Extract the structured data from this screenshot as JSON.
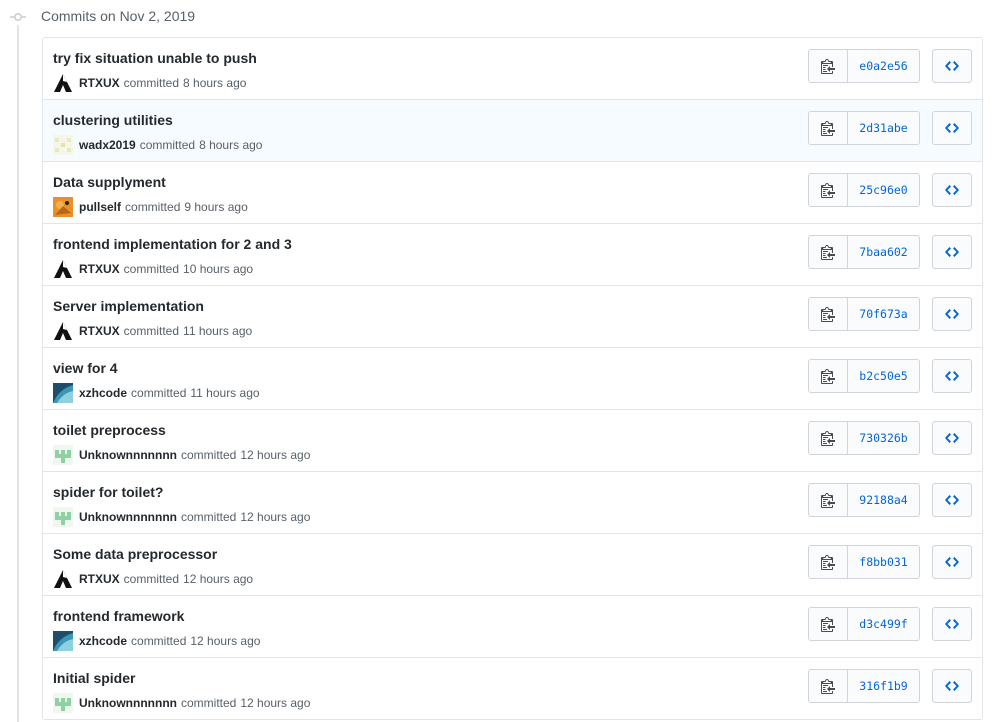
{
  "group": {
    "title": "Commits on Nov 2, 2019"
  },
  "colors": {
    "link": "#0366d6",
    "border": "#e1e4e8",
    "hover_row": "#f6fbff"
  },
  "icons": {
    "timeline": "git-commit-icon",
    "copy": "clippy-icon",
    "browse": "code-icon"
  },
  "commits": [
    {
      "message": "try fix situation unable to push",
      "author": "RTXUX",
      "verb": "committed",
      "time": "8 hours ago",
      "sha": "e0a2e56",
      "avatar": "rtxux"
    },
    {
      "message": "clustering utilities",
      "author": "wadx2019",
      "verb": "committed",
      "time": "8 hours ago",
      "sha": "2d31abe",
      "avatar": "wadx"
    },
    {
      "message": "Data supplyment",
      "author": "pullself",
      "verb": "committed",
      "time": "9 hours ago",
      "sha": "25c96e0",
      "avatar": "pullself"
    },
    {
      "message": "frontend implementation for 2 and 3",
      "author": "RTXUX",
      "verb": "committed",
      "time": "10 hours ago",
      "sha": "7baa602",
      "avatar": "rtxux"
    },
    {
      "message": "Server implementation",
      "author": "RTXUX",
      "verb": "committed",
      "time": "11 hours ago",
      "sha": "70f673a",
      "avatar": "rtxux"
    },
    {
      "message": "view for 4",
      "author": "xzhcode",
      "verb": "committed",
      "time": "11 hours ago",
      "sha": "b2c50e5",
      "avatar": "xzhcode"
    },
    {
      "message": "toilet preprocess",
      "author": "Unknownnnnnnn",
      "verb": "committed",
      "time": "12 hours ago",
      "sha": "730326b",
      "avatar": "unknown"
    },
    {
      "message": "spider for toilet?",
      "author": "Unknownnnnnnn",
      "verb": "committed",
      "time": "12 hours ago",
      "sha": "92188a4",
      "avatar": "unknown"
    },
    {
      "message": "Some data preprocessor",
      "author": "RTXUX",
      "verb": "committed",
      "time": "12 hours ago",
      "sha": "f8bb031",
      "avatar": "rtxux"
    },
    {
      "message": "frontend framework",
      "author": "xzhcode",
      "verb": "committed",
      "time": "12 hours ago",
      "sha": "d3c499f",
      "avatar": "xzhcode"
    },
    {
      "message": "Initial spider",
      "author": "Unknownnnnnnn",
      "verb": "committed",
      "time": "12 hours ago",
      "sha": "316f1b9",
      "avatar": "unknown"
    }
  ]
}
